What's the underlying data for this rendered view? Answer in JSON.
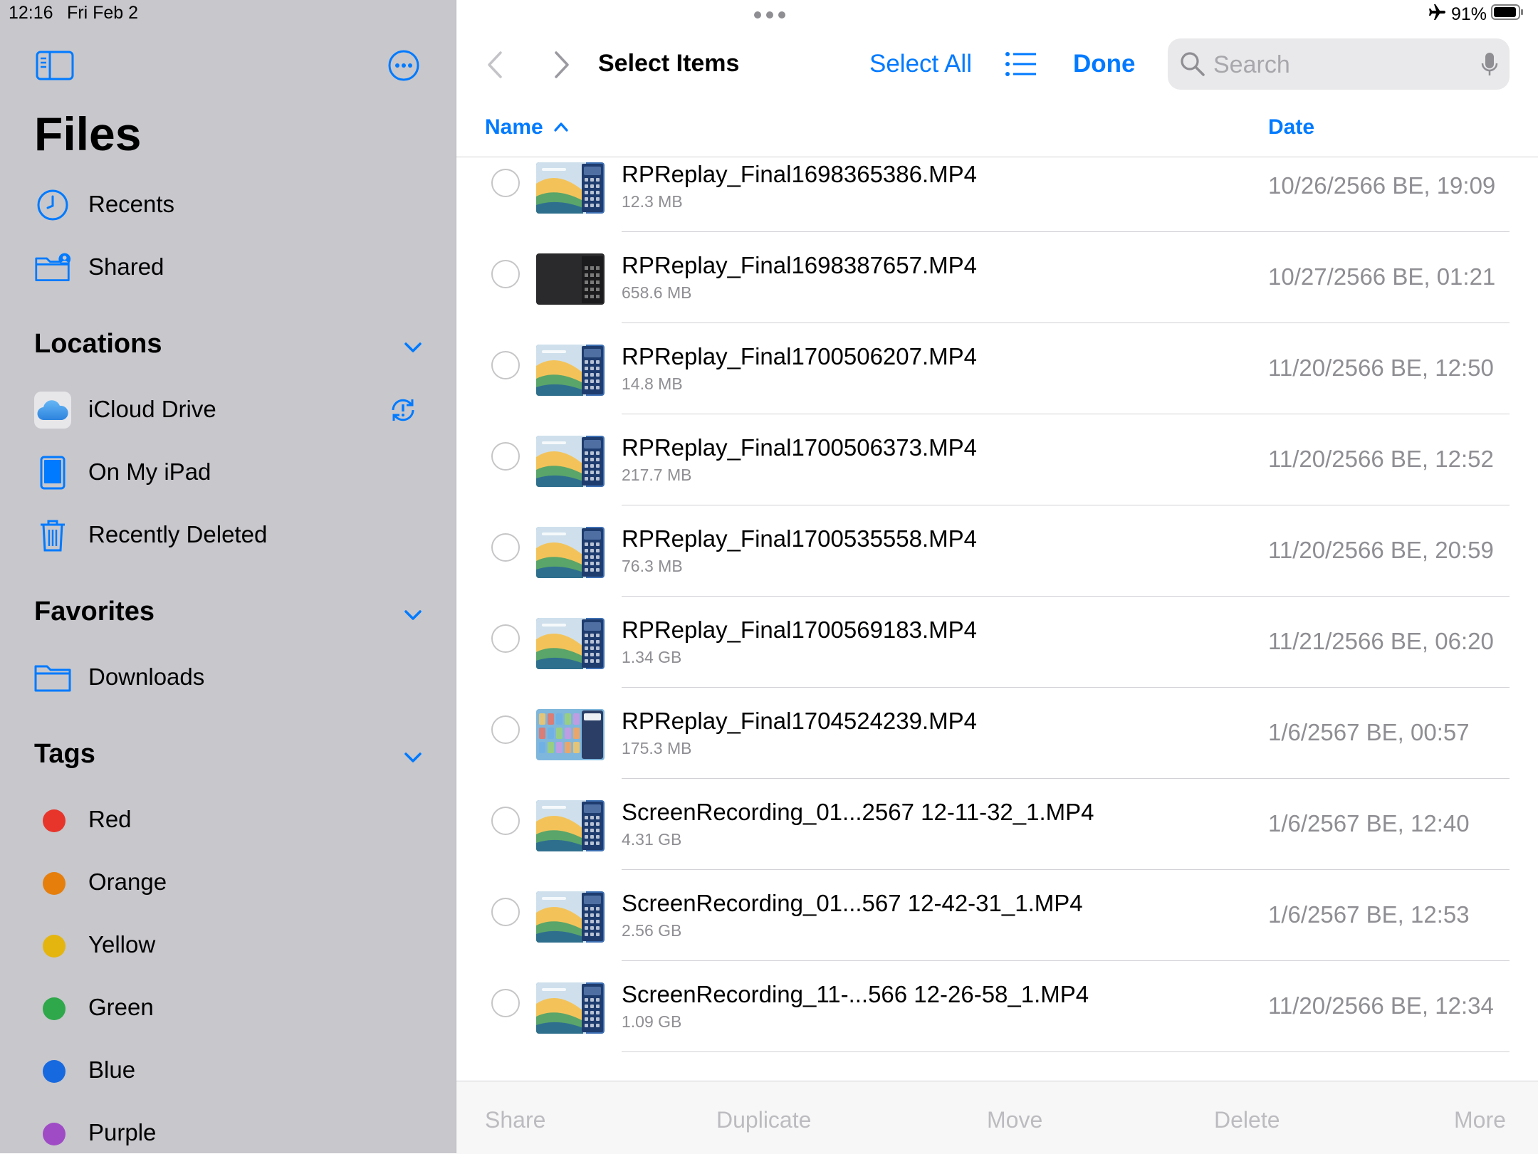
{
  "status": {
    "time": "12:16",
    "date": "Fri Feb 2",
    "battery": "91%"
  },
  "sidebar": {
    "title": "Files",
    "top_items": [
      {
        "label": "Recents",
        "icon": "clock-icon"
      },
      {
        "label": "Shared",
        "icon": "shared-folder-icon"
      }
    ],
    "locations": {
      "header": "Locations",
      "items": [
        {
          "label": "iCloud Drive",
          "icon": "icloud-icon"
        },
        {
          "label": "On My iPad",
          "icon": "ipad-icon"
        },
        {
          "label": "Recently Deleted",
          "icon": "trash-icon"
        }
      ]
    },
    "favorites": {
      "header": "Favorites",
      "items": [
        {
          "label": "Downloads",
          "icon": "folder-icon"
        }
      ]
    },
    "tags": {
      "header": "Tags",
      "items": [
        {
          "label": "Red",
          "color": "#e8352b"
        },
        {
          "label": "Orange",
          "color": "#e67e0c"
        },
        {
          "label": "Yellow",
          "color": "#e5b50f"
        },
        {
          "label": "Green",
          "color": "#2ea84a"
        },
        {
          "label": "Blue",
          "color": "#1769e0"
        },
        {
          "label": "Purple",
          "color": "#a04bc6"
        }
      ]
    }
  },
  "nav": {
    "title": "Select Items",
    "select_all": "Select All",
    "done": "Done",
    "search_placeholder": "Search"
  },
  "columns": {
    "name": "Name",
    "date": "Date"
  },
  "files": [
    {
      "name": "RPReplay_Final1698365386.MP4",
      "size": "12.3 MB",
      "date": "10/26/2566 BE, 19:09",
      "thumb": "light"
    },
    {
      "name": "RPReplay_Final1698387657.MP4",
      "size": "658.6 MB",
      "date": "10/27/2566 BE, 01:21",
      "thumb": "dark"
    },
    {
      "name": "RPReplay_Final1700506207.MP4",
      "size": "14.8 MB",
      "date": "11/20/2566 BE, 12:50",
      "thumb": "light"
    },
    {
      "name": "RPReplay_Final1700506373.MP4",
      "size": "217.7 MB",
      "date": "11/20/2566 BE, 12:52",
      "thumb": "light"
    },
    {
      "name": "RPReplay_Final1700535558.MP4",
      "size": "76.3 MB",
      "date": "11/20/2566 BE, 20:59",
      "thumb": "light"
    },
    {
      "name": "RPReplay_Final1700569183.MP4",
      "size": "1.34 GB",
      "date": "11/21/2566 BE, 06:20",
      "thumb": "light"
    },
    {
      "name": "RPReplay_Final1704524239.MP4",
      "size": "175.3 MB",
      "date": "1/6/2567 BE, 00:57",
      "thumb": "widgets"
    },
    {
      "name": "ScreenRecording_01...2567 12-11-32_1.MP4",
      "size": "4.31 GB",
      "date": "1/6/2567 BE, 12:40",
      "thumb": "light"
    },
    {
      "name": "ScreenRecording_01...567 12-42-31_1.MP4",
      "size": "2.56 GB",
      "date": "1/6/2567 BE, 12:53",
      "thumb": "light"
    },
    {
      "name": "ScreenRecording_11-...566 12-26-58_1.MP4",
      "size": "1.09 GB",
      "date": "11/20/2566 BE, 12:34",
      "thumb": "light"
    }
  ],
  "toolbar": {
    "share": "Share",
    "duplicate": "Duplicate",
    "move": "Move",
    "delete": "Delete",
    "more": "More"
  }
}
